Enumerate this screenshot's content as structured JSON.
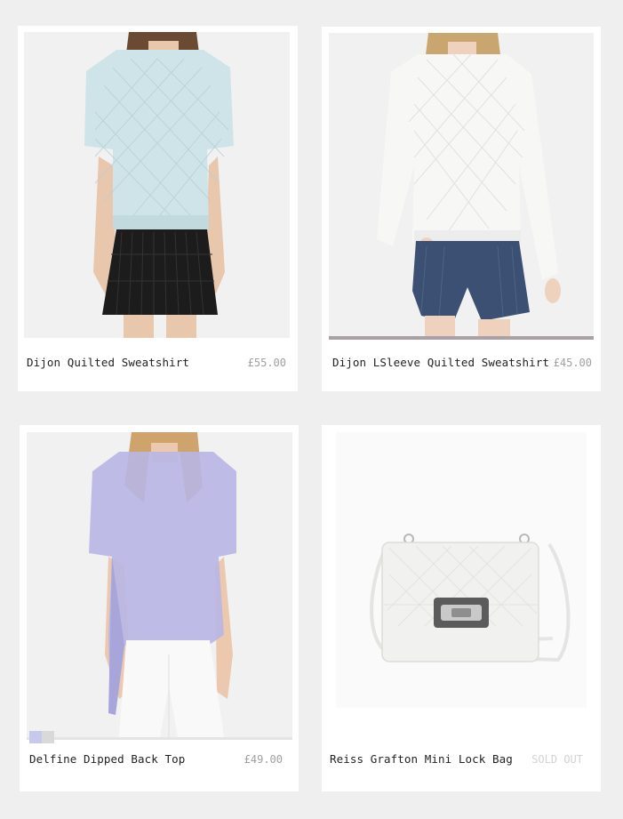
{
  "products": [
    {
      "name": "Dijon Quilted Sweatshirt",
      "price": "£55.00",
      "image_alt": "Pale blue quilted short-sleeve sweatshirt with black pleated skirt"
    },
    {
      "name": "Dijon LSleeve Quilted Sweatshirt",
      "price": "£45.00",
      "image_alt": "White quilted long-sleeve sweatshirt with denim shorts"
    },
    {
      "name": "Delfine Dipped Back Top",
      "price": "£49.00",
      "image_alt": "Lilac sheer dipped-back top with white trousers",
      "swatch_colors": [
        "#c7c9ec",
        "#d9d9d9"
      ]
    },
    {
      "name": "Reiss Grafton Mini Lock Bag",
      "price": "SOLD OUT",
      "image_alt": "White quilted mini bag with silver lock and strap"
    }
  ],
  "colors": {
    "page_background": "#efefef",
    "card_background": "#ffffff",
    "price_text": "#a0a0a0",
    "sold_out_text": "#d2d2d2",
    "hover_bar": "#aaa0a6"
  }
}
